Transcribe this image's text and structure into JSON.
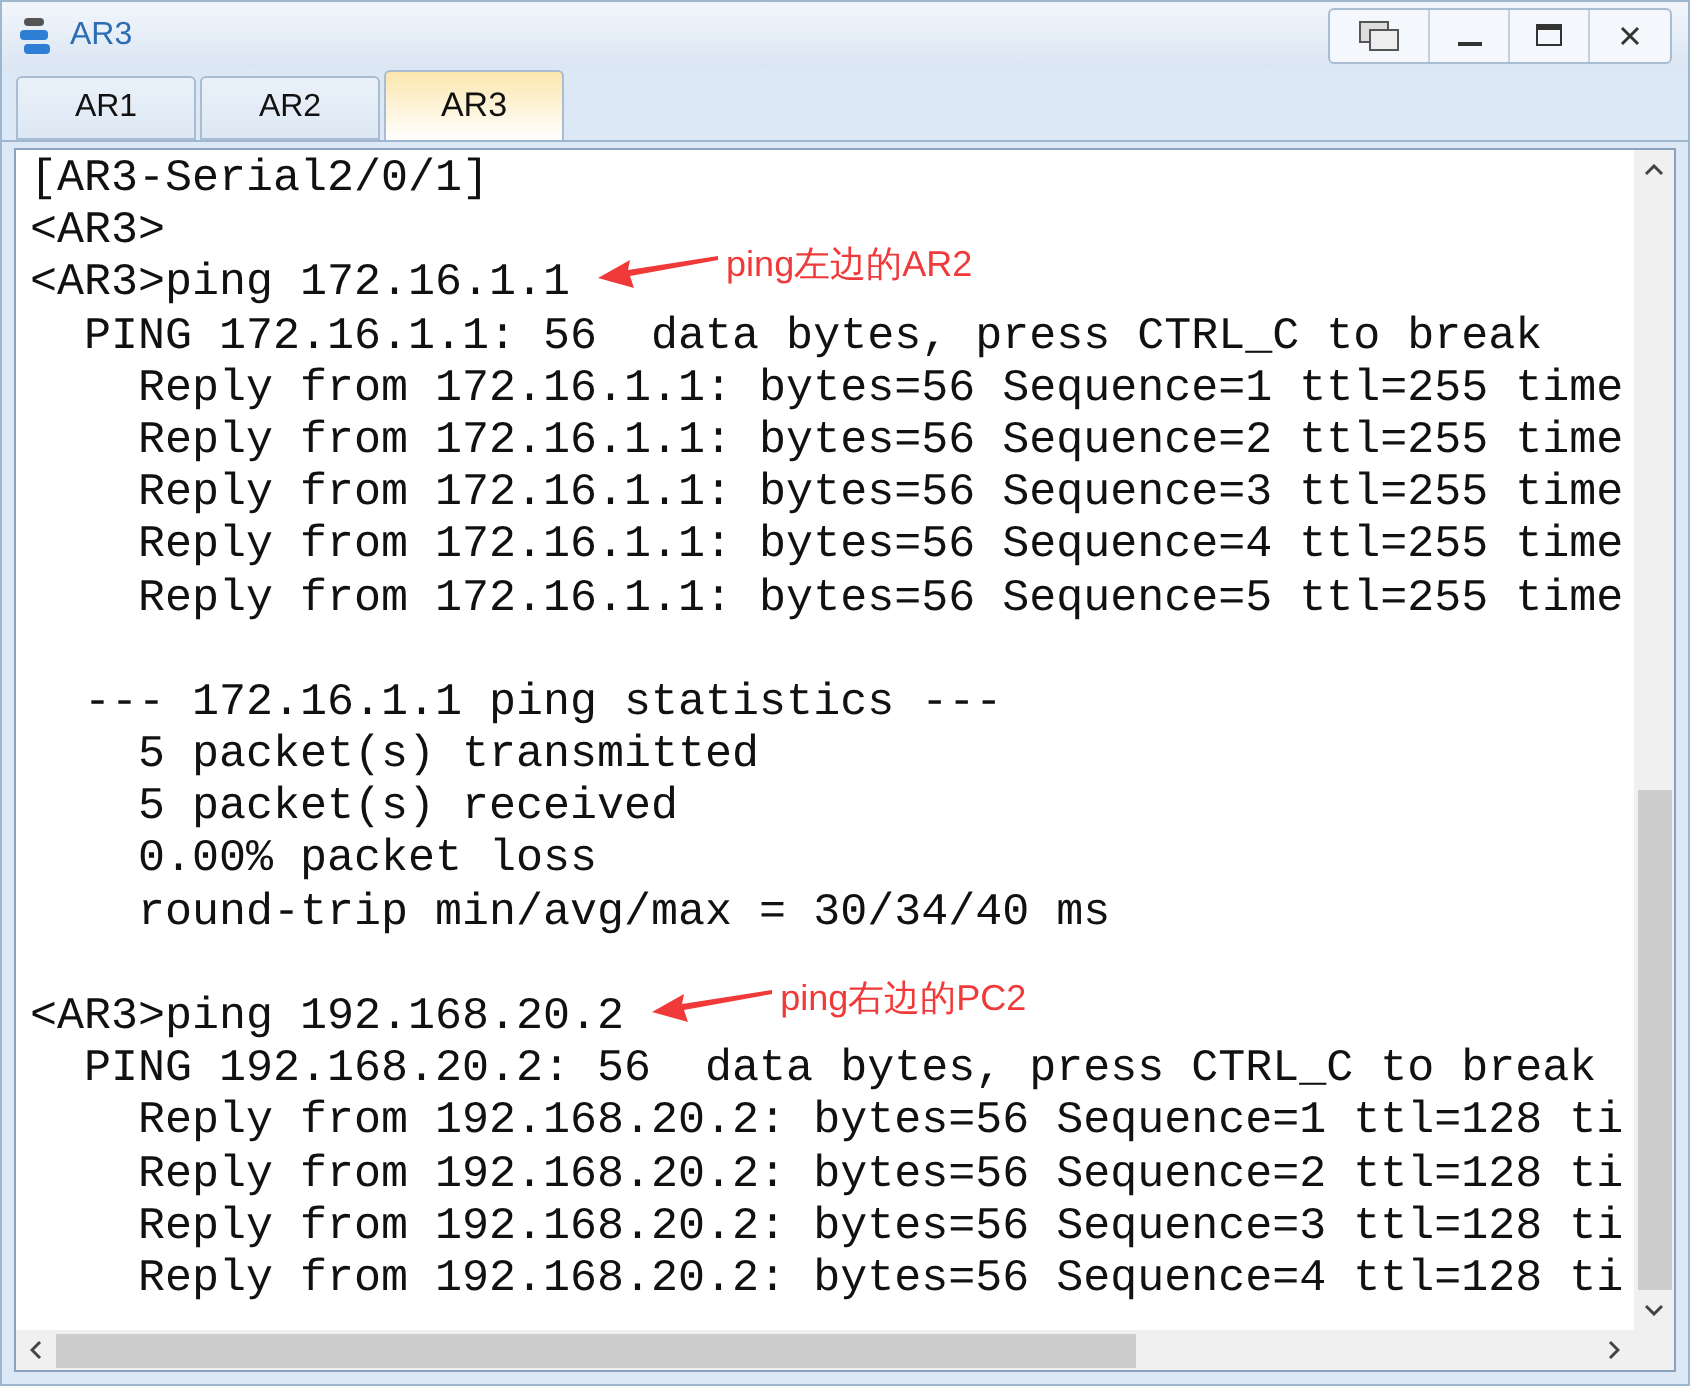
{
  "window": {
    "title": "AR3"
  },
  "tabs": [
    {
      "label": "AR1",
      "selected": false
    },
    {
      "label": "AR2",
      "selected": false
    },
    {
      "label": "AR3",
      "selected": true
    }
  ],
  "terminal": {
    "lines": [
      {
        "kind": "text",
        "text": "[AR3-Serial2/0/1]"
      },
      {
        "kind": "text",
        "text": "<AR3>"
      },
      {
        "kind": "text",
        "text": "<AR3>ping 172.16.1.1",
        "annotation": "ping左边的AR2"
      },
      {
        "kind": "text",
        "text": "  PING 172.16.1.1: 56  data bytes, press CTRL_C to break"
      },
      {
        "kind": "text",
        "text": "    Reply from 172.16.1.1: bytes=56 Sequence=1 ttl=255 time"
      },
      {
        "kind": "text",
        "text": "    Reply from 172.16.1.1: bytes=56 Sequence=2 ttl=255 time"
      },
      {
        "kind": "text",
        "text": "    Reply from 172.16.1.1: bytes=56 Sequence=3 ttl=255 time"
      },
      {
        "kind": "text",
        "text": "    Reply from 172.16.1.1: bytes=56 Sequence=4 ttl=255 time"
      },
      {
        "kind": "text",
        "text": "    Reply from 172.16.1.1: bytes=56 Sequence=5 ttl=255 time"
      },
      {
        "kind": "blank"
      },
      {
        "kind": "text",
        "text": "  --- 172.16.1.1 ping statistics ---"
      },
      {
        "kind": "text",
        "text": "    5 packet(s) transmitted"
      },
      {
        "kind": "text",
        "text": "    5 packet(s) received"
      },
      {
        "kind": "text",
        "text": "    0.00% packet loss"
      },
      {
        "kind": "text",
        "text": "    round-trip min/avg/max = 30/34/40 ms"
      },
      {
        "kind": "blank"
      },
      {
        "kind": "text",
        "text": "<AR3>ping 192.168.20.2",
        "annotation": "ping右边的PC2"
      },
      {
        "kind": "text",
        "text": "  PING 192.168.20.2: 56  data bytes, press CTRL_C to break"
      },
      {
        "kind": "text",
        "text": "    Reply from 192.168.20.2: bytes=56 Sequence=1 ttl=128 ti"
      },
      {
        "kind": "text",
        "text": "    Reply from 192.168.20.2: bytes=56 Sequence=2 ttl=128 ti"
      },
      {
        "kind": "text",
        "text": "    Reply from 192.168.20.2: bytes=56 Sequence=3 ttl=128 ti"
      },
      {
        "kind": "text",
        "text": "    Reply from 192.168.20.2: bytes=56 Sequence=4 ttl=128 ti"
      }
    ]
  }
}
